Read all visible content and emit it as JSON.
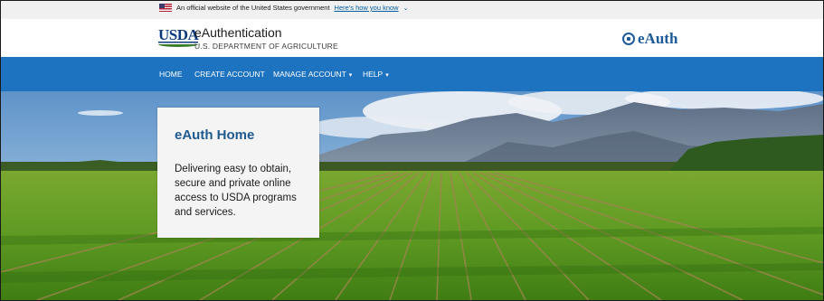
{
  "gov_banner": {
    "text": "An official website of the United States government",
    "link": "Here's how you know",
    "chevron": "chevron-down-icon"
  },
  "header": {
    "logo_text": "USDA",
    "title": "eAuthentication",
    "subtitle": "U.S. DEPARTMENT OF AGRICULTURE",
    "brand": "eAuth",
    "brand_icon": "eauth-seal-icon"
  },
  "nav": {
    "items": [
      {
        "label": "HOME"
      },
      {
        "label": "CREATE ACCOUNT"
      },
      {
        "label": "MANAGE ACCOUNT",
        "dropdown": true
      },
      {
        "label": "HELP",
        "dropdown": true
      }
    ],
    "chevron": "▾"
  },
  "hero": {
    "title": "eAuth Home",
    "text": "Delivering easy to obtain, secure and private online access to USDA programs and services."
  },
  "colors": {
    "nav_bg": "#1e73c0",
    "brand_blue": "#1e5b99",
    "title_blue": "#1f5a8f",
    "banner_bg": "#f0f0f0"
  }
}
